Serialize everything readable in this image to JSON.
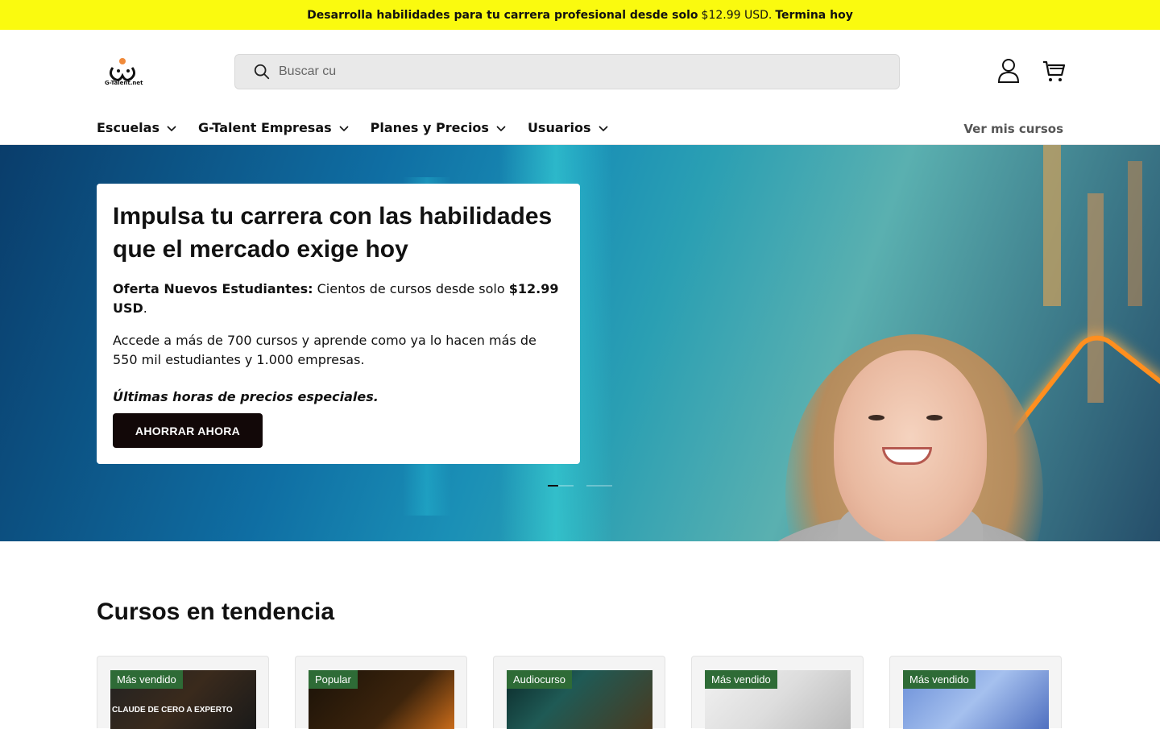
{
  "announcement": {
    "text_before": "Desarrolla habilidades para tu carrera profesional desde solo",
    "price": "$12.99 USD.",
    "text_after": "Termina hoy"
  },
  "header": {
    "logo_text": "G-Talent.net",
    "search_placeholder": "Buscar cu",
    "icons": [
      "search-icon",
      "account-icon",
      "cart-icon"
    ]
  },
  "nav": {
    "items": [
      {
        "label": "Escuelas"
      },
      {
        "label": "G-Talent Empresas"
      },
      {
        "label": "Planes y Precios"
      },
      {
        "label": "Usuarios"
      }
    ],
    "right_link": "Ver mis cursos"
  },
  "hero": {
    "title": "Impulsa tu carrera con las habilidades que el mercado exige hoy",
    "offer_label": "Oferta Nuevos Estudiantes:",
    "offer_text": "Cientos de cursos desde solo",
    "offer_price": "$12.99 USD",
    "offer_end": ".",
    "description": "Accede a más de 700 cursos y aprende como ya lo hacen más de 550 mil estudiantes y 1.000 empresas.",
    "note": "Últimas horas de precios especiales.",
    "cta": "AHORRAR AHORA",
    "slides": 2,
    "active_slide": 1
  },
  "trending": {
    "title": "Cursos en tendencia",
    "cards": [
      {
        "badge": "Más vendido",
        "image_text": "CLAUDE DE CERO A EXPERTO"
      },
      {
        "badge": "Popular",
        "image_text": ""
      },
      {
        "badge": "Audiocurso",
        "image_text": ""
      },
      {
        "badge": "Más vendido",
        "image_text": ""
      },
      {
        "badge": "Más vendido",
        "image_text": ""
      }
    ]
  },
  "colors": {
    "announcement_bg": "#fafa0f",
    "cta_bg": "#120808",
    "badge_bg": "#2e6b36"
  }
}
